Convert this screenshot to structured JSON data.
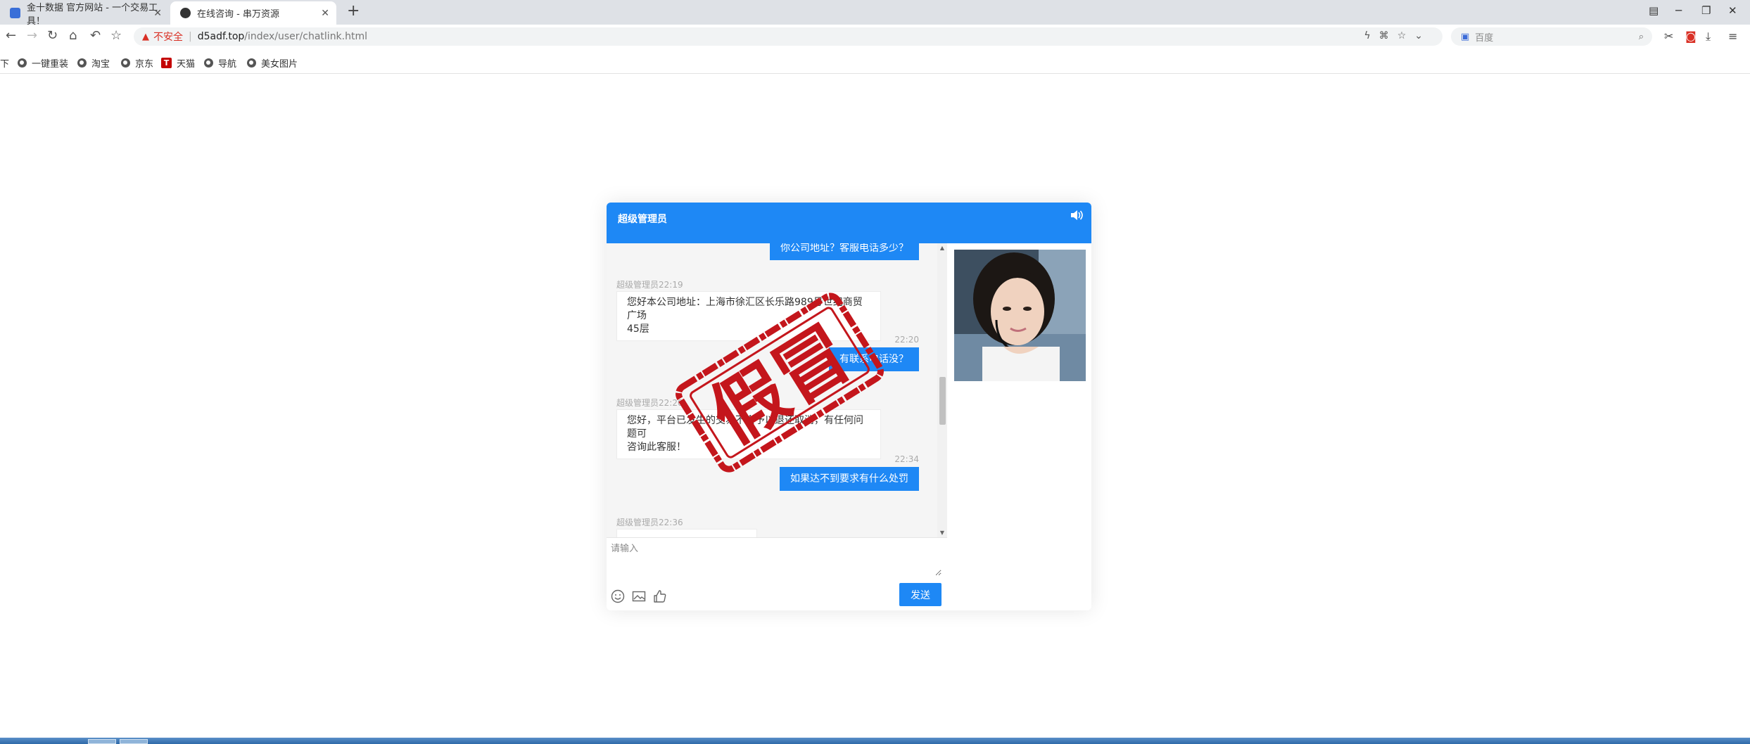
{
  "browser": {
    "tabs": [
      {
        "title": "金十数据 官方网站 - 一个交易工具！",
        "active": false
      },
      {
        "title": "在线咨询 - 串万资源",
        "active": true
      }
    ],
    "address": {
      "security_label": "不安全",
      "host": "d5adf.top",
      "path": "/index/user/chatlink.html"
    },
    "search_placeholder": "百度",
    "bookmarks": [
      "下",
      "一键重装",
      "淘宝",
      "京东",
      "天猫",
      "导航",
      "美女图片"
    ]
  },
  "chat": {
    "title": "超级管理员",
    "messages": [
      {
        "side": "out",
        "text": "你公司地址？客服电话多少？"
      },
      {
        "side": "in",
        "sender_time": "超级管理员22:19",
        "lines": [
          "您好本公司地址：上海市徐汇区长乐路989号世纪商贸广场",
          "45层"
        ]
      },
      {
        "side": "out",
        "time": "22:20",
        "text": "有联系电话没？"
      },
      {
        "side": "in",
        "sender_time": "超级管理员22:20",
        "lines": [
          "您好，平台已发生的交易不会予以退还取消，有任何问题可",
          "咨询此客服！"
        ]
      },
      {
        "side": "out",
        "time": "22:34",
        "text": "如果达不到要求有什么处罚"
      },
      {
        "side": "in",
        "sender_time": "超级管理员22:36",
        "lines": [
          ""
        ]
      }
    ],
    "input_placeholder": "请输入",
    "send_label": "发送"
  },
  "stamp": {
    "text": "假冒",
    "color": "#c4161c"
  },
  "colors": {
    "accent": "#1e88f5",
    "warning": "#d93025"
  }
}
